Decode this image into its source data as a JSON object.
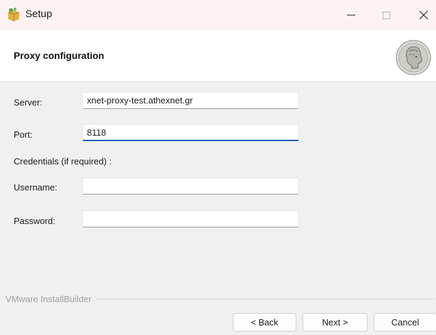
{
  "window": {
    "title": "Setup",
    "icons": {
      "app": "installer-box-icon",
      "minimize": "minimize-icon",
      "maximize": "maximize-icon",
      "close": "close-icon"
    }
  },
  "header": {
    "title": "Proxy configuration",
    "logo": "coin-medallion-logo"
  },
  "form": {
    "server_label": "Server:",
    "server_value": "xnet-proxy-test.athexnet.gr",
    "port_label": "Port:",
    "port_value": "8118",
    "credentials_label": "Credentials (if required) :",
    "username_label": "Username:",
    "username_value": "",
    "password_label": "Password:",
    "password_value": ""
  },
  "footer": {
    "brand": "VMware InstallBuilder",
    "back_label": "< Back",
    "next_label": "Next >",
    "cancel_label": "Cancel"
  },
  "colors": {
    "titlebar_bg": "#fbf3f1",
    "header_bg": "#ffffff",
    "body_bg": "#f0f0f0",
    "focus_accent": "#1c5fb8"
  }
}
